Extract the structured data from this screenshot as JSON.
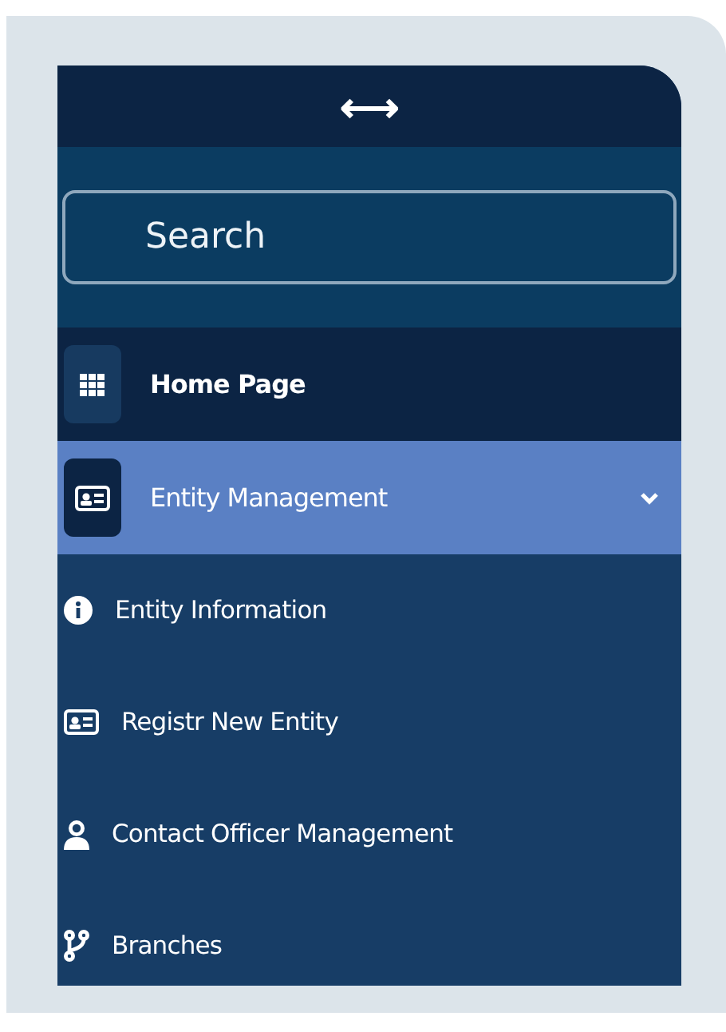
{
  "toggle": {
    "glyph": "⟷"
  },
  "search": {
    "placeholder": "Search"
  },
  "menu": [
    {
      "label": "Home Page",
      "selected": false
    },
    {
      "label": "Entity Management",
      "selected": true,
      "expanded": true,
      "children": [
        {
          "label": "Entity Information"
        },
        {
          "label": "Registr New Entity"
        },
        {
          "label": "Contact Officer Management"
        },
        {
          "label": "Branches"
        }
      ]
    }
  ]
}
